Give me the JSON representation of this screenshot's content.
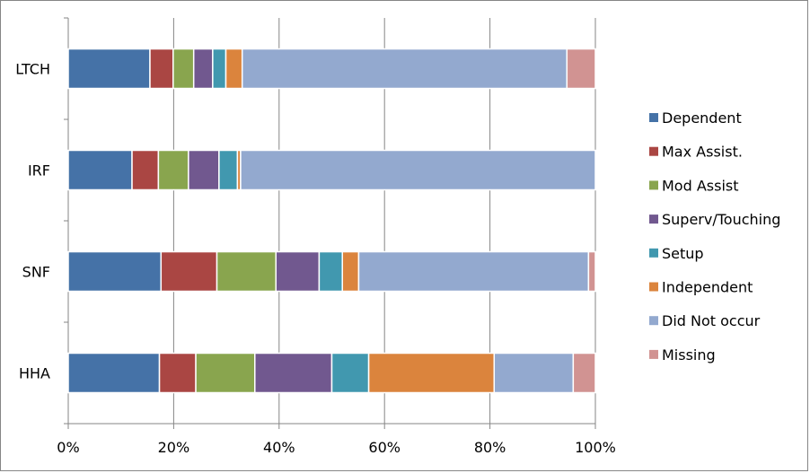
{
  "chart_data": {
    "type": "bar",
    "orientation": "horizontal",
    "stacked": "percent",
    "title": "",
    "xlabel": "",
    "ylabel": "",
    "xlim": [
      0,
      100
    ],
    "x_ticks": [
      "0%",
      "20%",
      "40%",
      "60%",
      "80%",
      "100%"
    ],
    "x_tick_values": [
      0,
      20,
      40,
      60,
      80,
      100
    ],
    "grid": true,
    "legend_position": "right",
    "categories": [
      "LTCH",
      "IRF",
      "SNF",
      "HHA"
    ],
    "series": [
      {
        "name": "Dependent",
        "color": "#4572A7",
        "values": [
          15.5,
          12.1,
          17.6,
          17.3
        ]
      },
      {
        "name": "Max Assist.",
        "color": "#AA4643",
        "values": [
          4.4,
          5.0,
          10.6,
          6.9
        ]
      },
      {
        "name": "Mod Assist",
        "color": "#89A54E",
        "values": [
          3.9,
          5.7,
          11.2,
          11.2
        ]
      },
      {
        "name": "Superv/Touching",
        "color": "#71588F",
        "values": [
          3.6,
          5.8,
          8.2,
          14.6
        ]
      },
      {
        "name": "Setup",
        "color": "#4198AF",
        "values": [
          2.5,
          3.5,
          4.4,
          7.0
        ]
      },
      {
        "name": "Independent",
        "color": "#DB843D",
        "values": [
          3.1,
          0.6,
          3.1,
          23.8
        ]
      },
      {
        "name": "Did Not occur",
        "color": "#93A9CF",
        "values": [
          61.6,
          67.3,
          43.6,
          15.0
        ]
      },
      {
        "name": "Missing",
        "color": "#D19392",
        "values": [
          5.4,
          0.0,
          1.3,
          4.2
        ]
      }
    ]
  }
}
